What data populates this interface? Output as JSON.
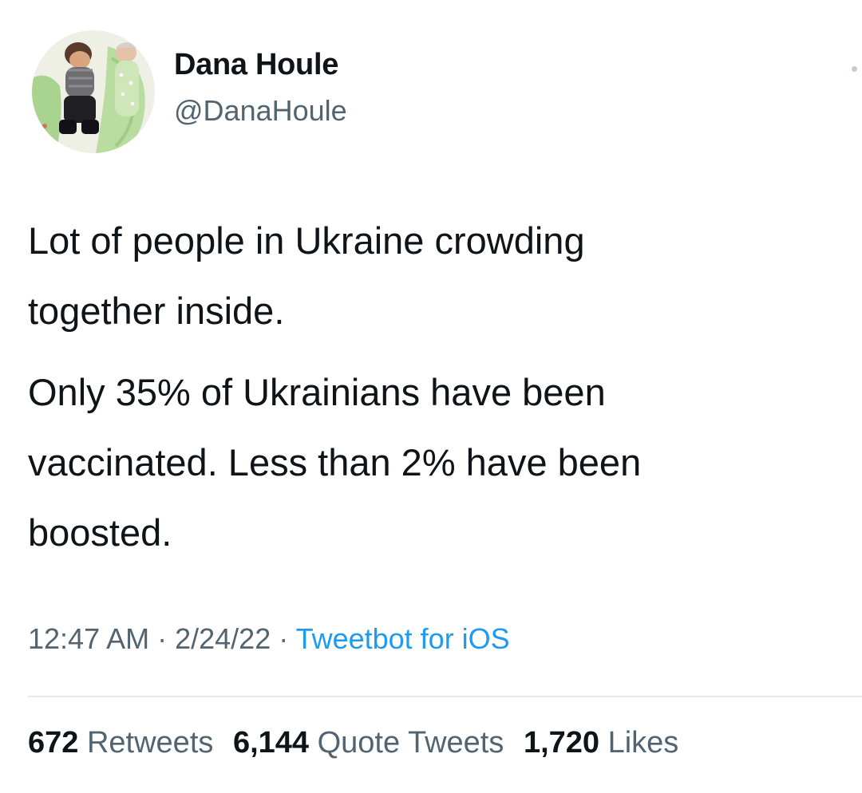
{
  "author": {
    "display_name": "Dana Houle",
    "handle": "@DanaHoule"
  },
  "tweet": {
    "paragraph_1_line_1": "Lot of people in Ukraine crowding",
    "paragraph_1_line_2": "together inside.",
    "paragraph_2_line_1": "Only 35% of Ukrainians have been",
    "paragraph_2_line_2": "vaccinated. Less than 2% have been",
    "paragraph_2_line_3": "boosted."
  },
  "meta": {
    "time": "12:47 AM",
    "separator": " · ",
    "date": "2/24/22",
    "source": "Tweetbot for iOS"
  },
  "stats": {
    "retweets_count": "672",
    "retweets_label": "Retweets",
    "quotes_count": "6,144",
    "quotes_label": "Quote Tweets",
    "likes_count": "1,720",
    "likes_label": "Likes"
  },
  "colors": {
    "text": "#0f1419",
    "secondary": "#536471",
    "link": "#1d9bf0",
    "divider": "#e6e9eb"
  }
}
